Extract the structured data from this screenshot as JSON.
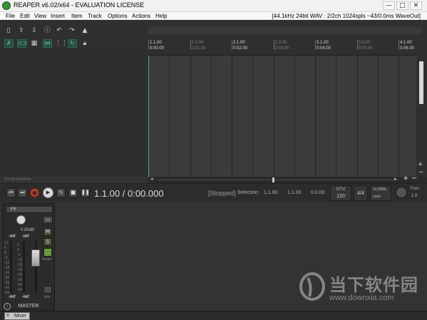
{
  "window": {
    "title": "REAPER v6.02/x64 - EVALUATION LICENSE",
    "minimize": "—",
    "maximize": "□",
    "close": "✕"
  },
  "menu": {
    "items": [
      "File",
      "Edit",
      "View",
      "Insert",
      "Item",
      "Track",
      "Options",
      "Actions",
      "Help"
    ],
    "audio_status": "[44.1kHz 24bit WAV : 2/2ch 1024spls ~43/0.0ms WaveOut]"
  },
  "toolbar": {
    "icons": [
      "new-project-icon",
      "open-project-icon",
      "save-project-icon",
      "project-settings-icon",
      "undo-icon",
      "redo-icon",
      "metronome-icon",
      "ripple-edit-icon",
      "loop-icon",
      "snap-grid-icon",
      "crossfade-icon",
      "grid-lines-icon",
      "auto-crossfade-icon",
      "lock-icon"
    ]
  },
  "timeline": {
    "bars": [
      {
        "bar": "1.1.00",
        "time": "0:00.00",
        "major": true
      },
      {
        "bar": "1.3.00",
        "time": "0:01.00",
        "major": false
      },
      {
        "bar": "2.1.00",
        "time": "0:02.00",
        "major": true
      },
      {
        "bar": "2.3.00",
        "time": "0:03.00",
        "major": false
      },
      {
        "bar": "3.1.00",
        "time": "0:04.00",
        "major": true
      },
      {
        "bar": "3.3.00",
        "time": "0:05.00",
        "major": false
      },
      {
        "bar": "4.1.00",
        "time": "0:06.00",
        "major": true
      }
    ],
    "scroll_label": "Scroll timeline"
  },
  "transport": {
    "position": "1.1.00 / 0:00.000",
    "state": "[Stopped]",
    "selection_label": "Selection:",
    "selection_start": "1.1.00",
    "selection_end": "1.1.00",
    "selection_length": "0.0.00",
    "bpm_label": "BPM",
    "bpm": "120",
    "time_signature": "4/4",
    "global_label": "GLOBAL",
    "global_value": "none",
    "rate_label": "Rate:",
    "rate": "1.0"
  },
  "mixer": {
    "fx_label": "FX",
    "io_label": "▭",
    "volume_db": "0.00dB",
    "peak_left": "-inf",
    "peak_right": "-inf",
    "peak_left_bottom": "-inf",
    "peak_right_bottom": "-inf",
    "scale_left": [
      "12",
      "6",
      "0",
      "-6",
      "-12",
      "-18",
      "-24",
      "-30",
      "-36",
      "-42",
      "-54"
    ],
    "scale_right": [
      "6",
      "0",
      "-6",
      "-12",
      "-18",
      "-24",
      "-30",
      "-36",
      "-42",
      "-54"
    ],
    "mute": "M",
    "solo": "S",
    "route_label": "Route",
    "mono_label": "trim",
    "master_label": "MASTER",
    "info_icon": "i"
  },
  "docker": {
    "close": "x",
    "tab_label": "Mixer"
  },
  "watermark": {
    "title": "当下软件园",
    "url": "www.downxia.com"
  },
  "colors": {
    "background": "#333333",
    "accent_green": "#4dd39a",
    "record_red": "#a84a38",
    "playcursor": "#45a88a"
  }
}
